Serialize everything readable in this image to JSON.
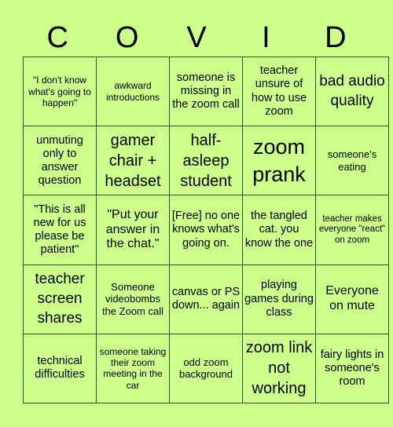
{
  "header": {
    "letters": [
      "C",
      "O",
      "V",
      "I",
      "D"
    ]
  },
  "board": {
    "rows": [
      [
        "\"I don't know what's going to happen\"",
        "awkward introductions",
        "someone is missing in the zoom call",
        "teacher unsure of how to use zoom",
        "bad audio quality"
      ],
      [
        "unmuting only to answer question",
        "gamer chair + headset",
        "half-asleep student",
        "zoom prank",
        "someone's eating"
      ],
      [
        "\"This is all new for us please be patient\"",
        "\"Put your answer in the chat.\"",
        "[Free] no one knows what's going on.",
        "the tangled cat. you know the one",
        "teacher makes everyone \"react\" on zoom"
      ],
      [
        "teacher screen shares",
        "Someone videobombs the Zoom call",
        "canvas or PS down... again",
        "playing games during class",
        "Everyone on mute"
      ],
      [
        "technical difficulties",
        "someone taking their zoom meeting in the car",
        "odd zoom background",
        "zoom link not working",
        "fairy lights in someone's room"
      ]
    ]
  },
  "colors": {
    "background": "#ccff8c",
    "grid_line": "#3b4a2a",
    "text": "#000000"
  }
}
